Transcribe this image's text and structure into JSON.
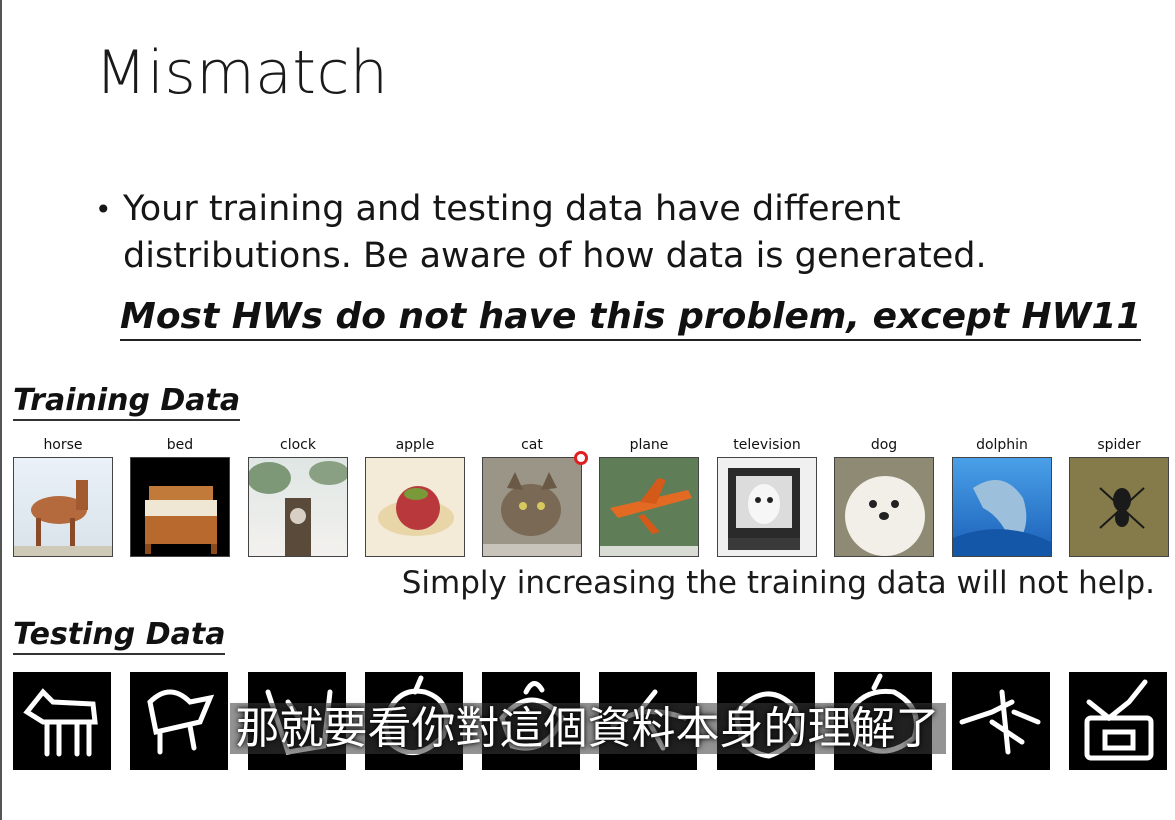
{
  "slide": {
    "title": "Mismatch",
    "bullet": "Your training and testing data have different distributions.  Be aware of how data is generated.",
    "emphasis": "Most HWs do not have this problem, except HW11",
    "training_label": "Training Data",
    "testing_label": "Testing Data",
    "note": "Simply increasing the training data will not help.",
    "classes": [
      "horse",
      "bed",
      "clock",
      "apple",
      "cat",
      "plane",
      "television",
      "dog",
      "dolphin",
      "spider"
    ]
  },
  "subtitle": "那就要看你對這個資料本身的理解了",
  "colors": {
    "accent_cursor": "#e02020",
    "sketch_bg": "#000000"
  }
}
